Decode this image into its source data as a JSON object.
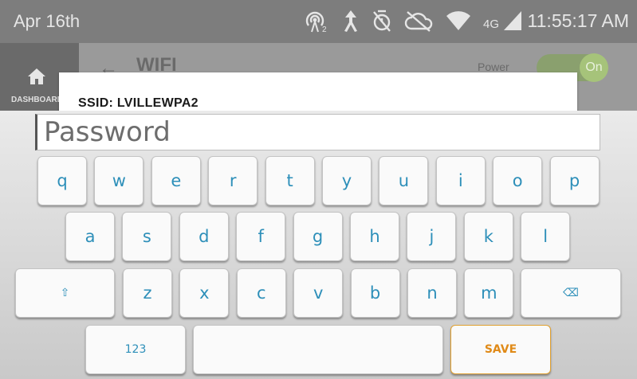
{
  "status_bar": {
    "date": "Apr 16th",
    "network_type": "4G",
    "time": "11:55:17 AM",
    "icons": [
      "hotspot-icon",
      "directions-icon",
      "alarm-off-icon",
      "cloud-off-icon",
      "wifi-icon",
      "signal-icon"
    ]
  },
  "app": {
    "nav_label": "DASHBOARD",
    "page_title": "WIFI",
    "power_label": "Power",
    "power_state": "On"
  },
  "dialog": {
    "ssid_text": "SSID: LVILLEWPA2"
  },
  "keyboard": {
    "password_placeholder": "Password",
    "password_value": "",
    "row1": [
      "q",
      "w",
      "e",
      "r",
      "t",
      "y",
      "u",
      "i",
      "o",
      "p"
    ],
    "row2": [
      "a",
      "s",
      "d",
      "f",
      "g",
      "h",
      "j",
      "k",
      "l"
    ],
    "shift_label": "⇧",
    "row3": [
      "z",
      "x",
      "c",
      "v",
      "b",
      "n",
      "m"
    ],
    "backspace_label": "⌫",
    "numbers_label": "123",
    "space_label": "",
    "save_label": "SAVE",
    "key_color": "#2d8fb9",
    "save_color": "#e08a18"
  }
}
